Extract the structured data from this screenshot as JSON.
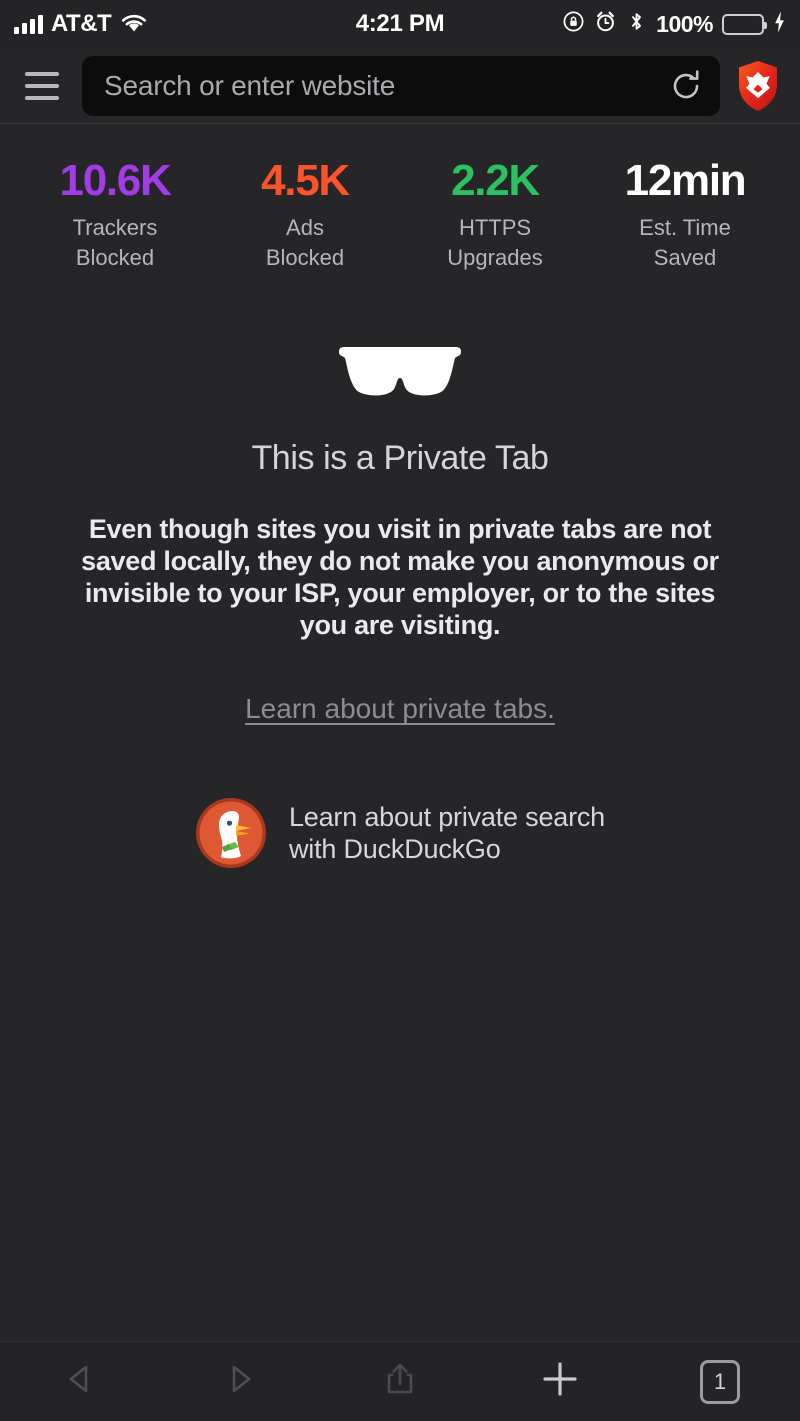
{
  "status_bar": {
    "carrier": "AT&T",
    "time": "4:21 PM",
    "battery_percent": "100%",
    "icons": [
      "signal-bars-icon",
      "wifi-icon",
      "rotation-lock-icon",
      "alarm-clock-icon",
      "bluetooth-icon",
      "battery-icon",
      "charging-bolt-icon"
    ]
  },
  "nav_bar": {
    "menu_icon": "hamburger-menu-icon",
    "url_placeholder": "Search or enter website",
    "url_value": "",
    "reload_icon": "reload-icon",
    "brave_icon": "brave-lion-shield-icon"
  },
  "stats": [
    {
      "value": "10.6K",
      "label_line1": "Trackers",
      "label_line2": "Blocked",
      "color": "#a13ce6"
    },
    {
      "value": "4.5K",
      "label_line1": "Ads",
      "label_line2": "Blocked",
      "color": "#fb542b"
    },
    {
      "value": "2.2K",
      "label_line1": "HTTPS",
      "label_line2": "Upgrades",
      "color": "#2bc25f"
    },
    {
      "value": "12min",
      "label_line1": "Est. Time",
      "label_line2": "Saved",
      "color": "#ffffff"
    }
  ],
  "private_tab": {
    "glasses_icon": "private-glasses-icon",
    "title": "This is a Private Tab",
    "body": "Even though sites you visit in private tabs are not saved locally, they do not make you anonymous or invisible to your ISP, your employer, or to the sites you are visiting.",
    "learn_link": "Learn about private tabs.",
    "ddg_line1": "Learn about private search",
    "ddg_line2": "with DuckDuckGo",
    "ddg_icon": "duckduckgo-logo-icon"
  },
  "toolbar": {
    "back_icon": "back-arrow-icon",
    "forward_icon": "forward-arrow-icon",
    "share_icon": "share-icon",
    "new_tab_icon": "plus-icon",
    "tab_count": "1"
  },
  "colors": {
    "background": "#262629",
    "chrome": "#242427",
    "brave_orange": "#fb542b",
    "accent_purple": "#a13ce6",
    "accent_green": "#2bc25f"
  }
}
